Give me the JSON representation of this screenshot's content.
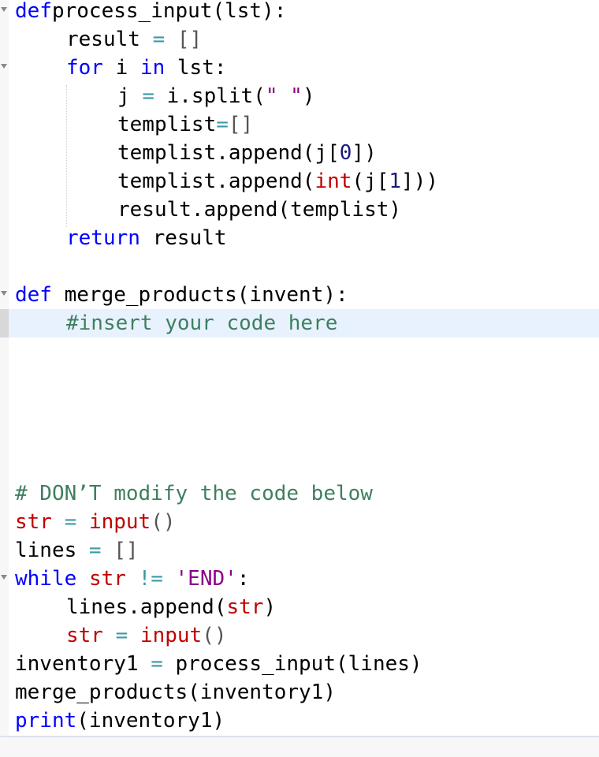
{
  "editor": {
    "language": "python",
    "lines": [
      {
        "indent": 0,
        "fold": true,
        "tokens": [
          [
            "kw",
            "def"
          ],
          [
            "",
            "process_input(lst):"
          ]
        ]
      },
      {
        "indent": 1,
        "fold": false,
        "tokens": [
          [
            "",
            "result "
          ],
          [
            "op",
            "="
          ],
          [
            "",
            " "
          ],
          [
            "br",
            "[]"
          ]
        ]
      },
      {
        "indent": 1,
        "fold": true,
        "tokens": [
          [
            "kw",
            "for"
          ],
          [
            "",
            " i "
          ],
          [
            "kw",
            "in"
          ],
          [
            "",
            " lst:"
          ]
        ]
      },
      {
        "indent": 2,
        "fold": false,
        "tokens": [
          [
            "",
            "j "
          ],
          [
            "op",
            "="
          ],
          [
            "",
            " i.split("
          ],
          [
            "str",
            "\" \""
          ],
          [
            "",
            ")"
          ]
        ]
      },
      {
        "indent": 2,
        "fold": false,
        "tokens": [
          [
            "",
            "templist"
          ],
          [
            "op",
            "="
          ],
          [
            "br",
            "[]"
          ]
        ]
      },
      {
        "indent": 2,
        "fold": false,
        "tokens": [
          [
            "",
            "templist.append(j["
          ],
          [
            "num",
            "0"
          ],
          [
            "",
            "])"
          ]
        ]
      },
      {
        "indent": 2,
        "fold": false,
        "tokens": [
          [
            "",
            "templist.append("
          ],
          [
            "bi",
            "int"
          ],
          [
            "",
            "(j["
          ],
          [
            "num",
            "1"
          ],
          [
            "",
            "]))"
          ]
        ]
      },
      {
        "indent": 2,
        "fold": false,
        "tokens": [
          [
            "",
            "result.append(templist)"
          ]
        ]
      },
      {
        "indent": 1,
        "fold": false,
        "tokens": [
          [
            "kw",
            "return"
          ],
          [
            "",
            " result"
          ]
        ]
      },
      {
        "indent": 0,
        "fold": false,
        "tokens": []
      },
      {
        "indent": 0,
        "fold": true,
        "tokens": [
          [
            "kw",
            "def"
          ],
          [
            "",
            " merge_products(invent):"
          ]
        ]
      },
      {
        "indent": 1,
        "fold": false,
        "active": true,
        "tokens": [
          [
            "cm",
            "#insert your code here"
          ]
        ]
      },
      {
        "indent": 0,
        "fold": false,
        "tokens": []
      },
      {
        "indent": 0,
        "fold": false,
        "tokens": []
      },
      {
        "indent": 0,
        "fold": false,
        "tokens": []
      },
      {
        "indent": 0,
        "fold": false,
        "tokens": []
      },
      {
        "indent": 0,
        "fold": false,
        "tokens": []
      },
      {
        "indent": 0,
        "fold": false,
        "tokens": [
          [
            "cm",
            "# DON’T modify the code below"
          ]
        ]
      },
      {
        "indent": 0,
        "fold": false,
        "tokens": [
          [
            "bi",
            "str"
          ],
          [
            "",
            " "
          ],
          [
            "op",
            "="
          ],
          [
            "",
            " "
          ],
          [
            "bi",
            "input"
          ],
          [
            "br",
            "()"
          ]
        ]
      },
      {
        "indent": 0,
        "fold": false,
        "tokens": [
          [
            "",
            "lines "
          ],
          [
            "op",
            "="
          ],
          [
            "",
            " "
          ],
          [
            "br",
            "[]"
          ]
        ]
      },
      {
        "indent": 0,
        "fold": true,
        "tokens": [
          [
            "kw",
            "while"
          ],
          [
            "",
            " "
          ],
          [
            "bi",
            "str"
          ],
          [
            "",
            " "
          ],
          [
            "op",
            "!="
          ],
          [
            "",
            " "
          ],
          [
            "str",
            "'END'"
          ],
          [
            "",
            ":"
          ]
        ]
      },
      {
        "indent": 1,
        "fold": false,
        "tokens": [
          [
            "",
            "lines.append("
          ],
          [
            "bi",
            "str"
          ],
          [
            "",
            ")"
          ]
        ]
      },
      {
        "indent": 1,
        "fold": false,
        "tokens": [
          [
            "bi",
            "str"
          ],
          [
            "",
            " "
          ],
          [
            "op",
            "="
          ],
          [
            "",
            " "
          ],
          [
            "bi",
            "input"
          ],
          [
            "br",
            "()"
          ]
        ]
      },
      {
        "indent": 0,
        "fold": false,
        "tokens": [
          [
            "",
            "inventory1 "
          ],
          [
            "op",
            "="
          ],
          [
            "",
            " process_input(lines)"
          ]
        ]
      },
      {
        "indent": 0,
        "fold": false,
        "tokens": [
          [
            "",
            "merge_products(inventory1)"
          ]
        ]
      },
      {
        "indent": 0,
        "fold": false,
        "tokens": [
          [
            "kw",
            "print"
          ],
          [
            "",
            "(inventory1)"
          ]
        ]
      }
    ]
  }
}
